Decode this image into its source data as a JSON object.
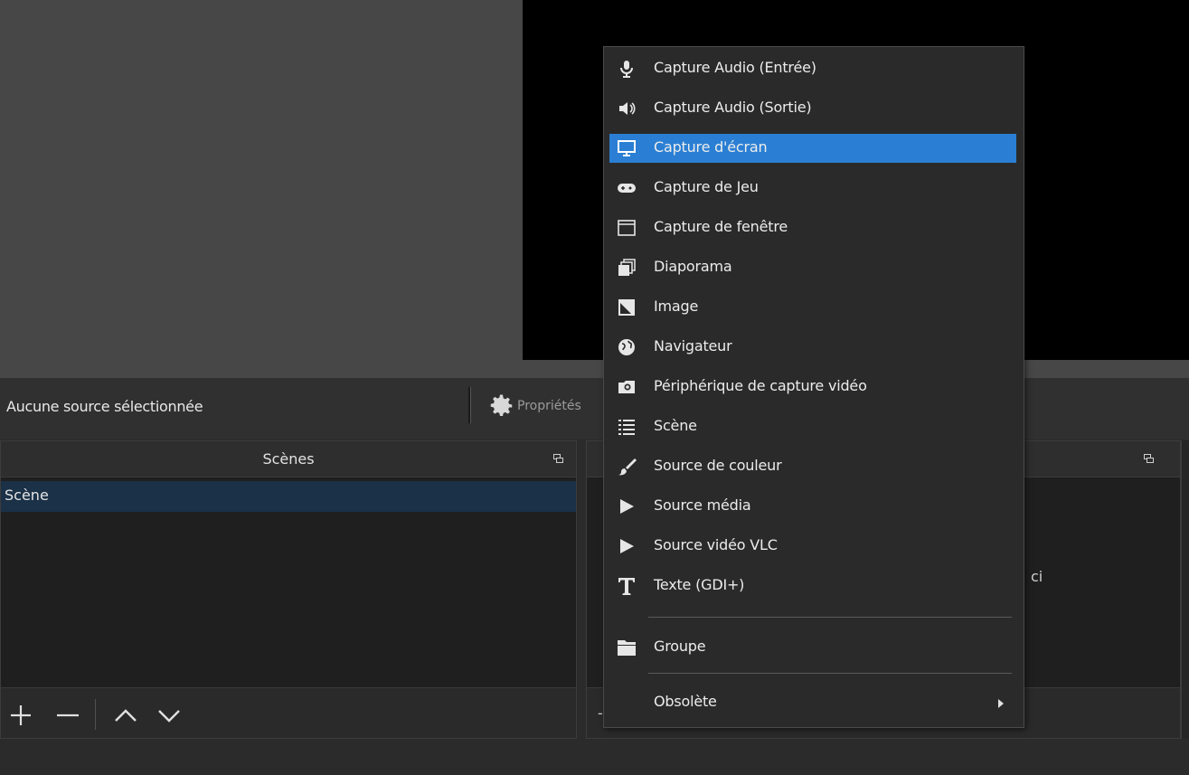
{
  "toolbar": {
    "no_source_label": "Aucune source sélectionnée",
    "properties_label": "Propriétés"
  },
  "scenes_dock": {
    "title": "Scènes",
    "items": [
      {
        "label": "Scène"
      }
    ]
  },
  "sources_dock": {
    "hint_fragment": "ci",
    "footer_fragment": "-"
  },
  "context_menu": {
    "items": [
      {
        "label": "Capture Audio (Entrée)",
        "icon": "microphone-icon"
      },
      {
        "label": "Capture Audio (Sortie)",
        "icon": "speaker-icon"
      },
      {
        "label": "Capture d'écran",
        "icon": "monitor-icon",
        "selected": true
      },
      {
        "label": "Capture de Jeu",
        "icon": "gamepad-icon"
      },
      {
        "label": "Capture de fenêtre",
        "icon": "window-icon"
      },
      {
        "label": "Diaporama",
        "icon": "slideshow-icon"
      },
      {
        "label": "Image",
        "icon": "image-icon"
      },
      {
        "label": "Navigateur",
        "icon": "globe-icon"
      },
      {
        "label": "Périphérique de capture vidéo",
        "icon": "camera-icon"
      },
      {
        "label": "Scène",
        "icon": "list-icon"
      },
      {
        "label": "Source de couleur",
        "icon": "brush-icon"
      },
      {
        "label": "Source média",
        "icon": "play-icon"
      },
      {
        "label": "Source vidéo VLC",
        "icon": "play-icon"
      },
      {
        "label": "Texte (GDI+)",
        "icon": "text-icon"
      },
      {
        "label": "Groupe",
        "icon": "folder-icon"
      },
      {
        "label": "Obsolète",
        "icon": "chevron-right-icon",
        "has_submenu": true
      }
    ]
  },
  "colors": {
    "selection": "#2a7fd4",
    "menu_bg": "#2a2a2a",
    "scene_selected": "#1b3147"
  }
}
